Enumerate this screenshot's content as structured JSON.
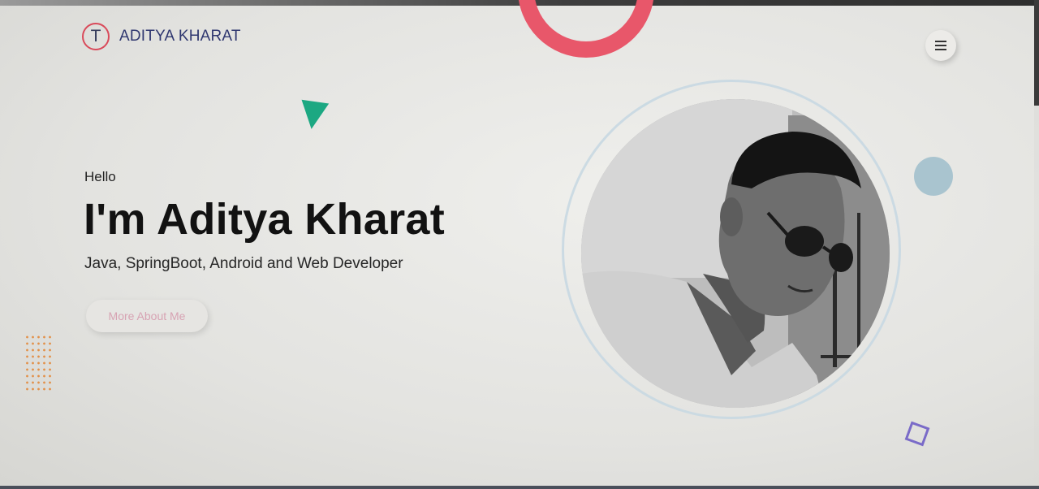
{
  "header": {
    "logo_letter": "T",
    "brand_name": "ADITYA KHARAT",
    "menu_icon": "hamburger-icon"
  },
  "hero": {
    "greeting": "Hello",
    "title": "I'm Aditya Kharat",
    "subtitle": "Java, SpringBoot, Android and Web Developer",
    "cta_label": "More About Me"
  },
  "portrait": {
    "icon": "profile-photo"
  },
  "colors": {
    "brand": "#2f3770",
    "accent_red": "#e8576a",
    "accent_green": "#1ca882",
    "accent_blue": "#a9c4cf",
    "accent_purple": "#7a6bc8",
    "accent_orange": "#e2914a",
    "cta_text": "#d7a3b3"
  }
}
